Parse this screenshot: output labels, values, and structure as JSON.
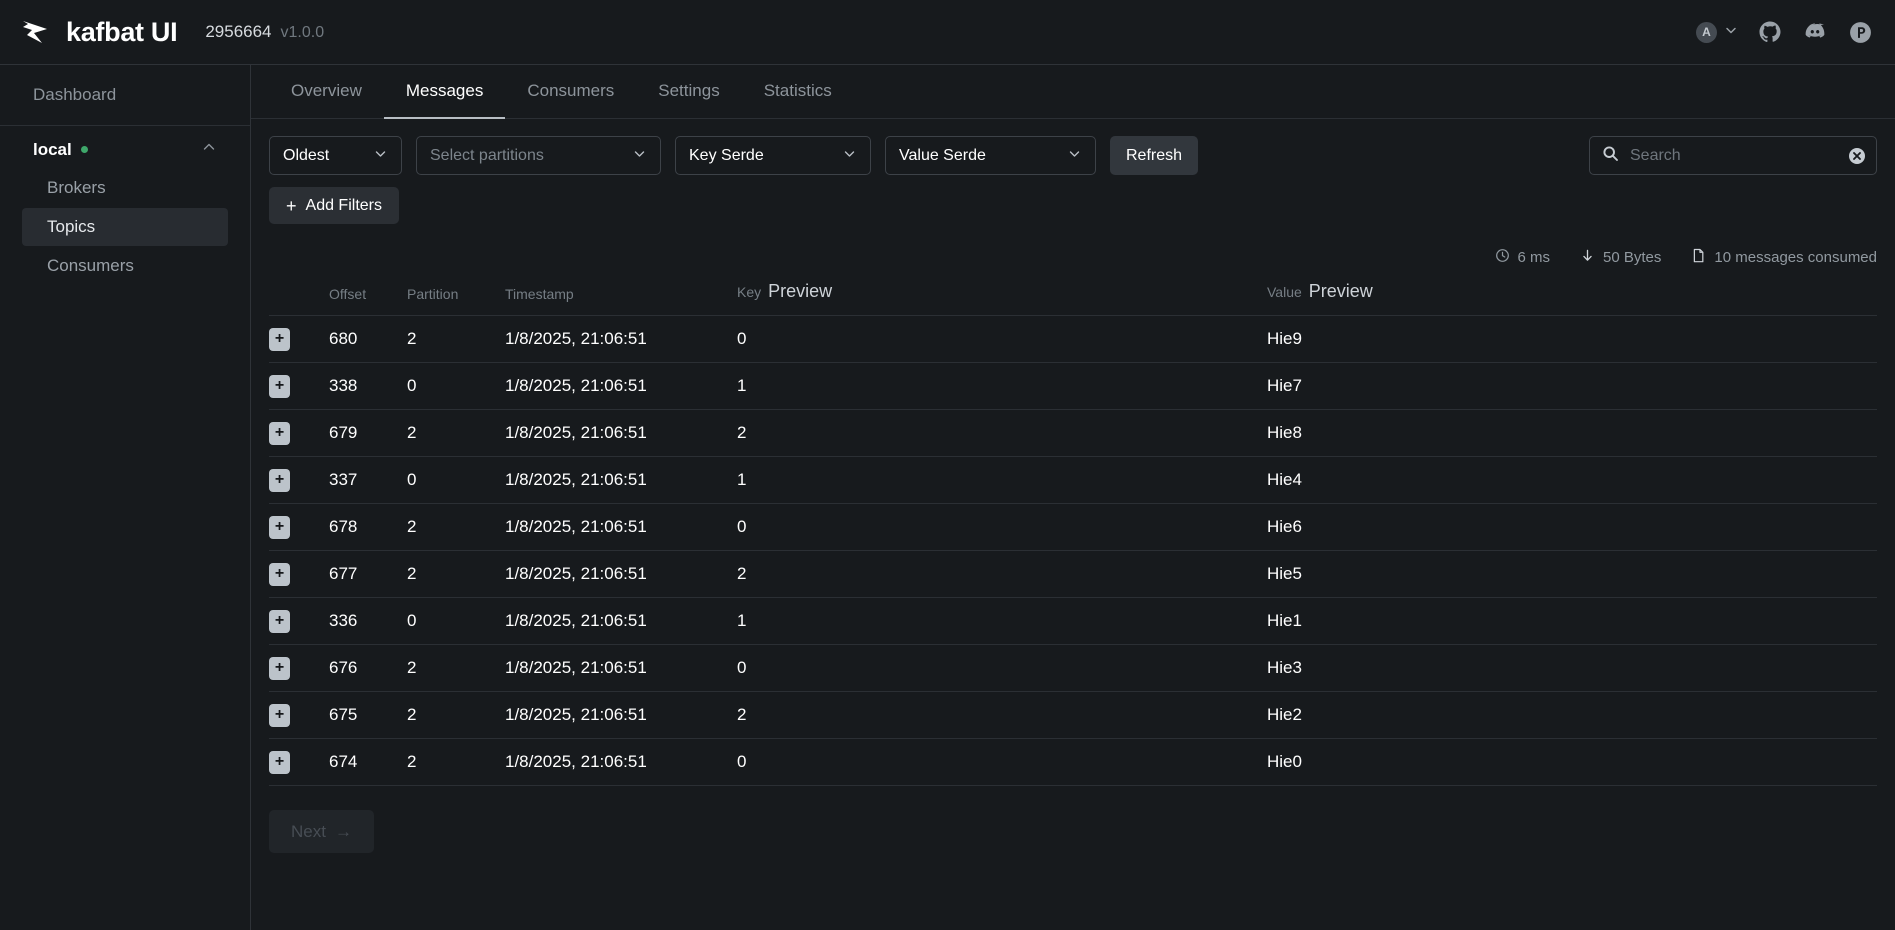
{
  "header": {
    "logo_icon": "kafbat-bird-logo",
    "brand": "kafbat UI",
    "build": "2956664",
    "version": "v1.0.0",
    "user_initial": "A",
    "user_chevron_icon": "chevron-down-icon",
    "github_icon": "github-icon",
    "discord_icon": "discord-icon",
    "product_icon": "circled-p-icon"
  },
  "sidebar": {
    "dashboard_label": "Dashboard",
    "cluster": {
      "name": "local",
      "status_color": "#3ea76a",
      "collapse_icon": "chevron-up-icon"
    },
    "items": [
      {
        "label": "Brokers",
        "active": false
      },
      {
        "label": "Topics",
        "active": true
      },
      {
        "label": "Consumers",
        "active": false
      }
    ]
  },
  "tabs": [
    {
      "label": "Overview",
      "active": false
    },
    {
      "label": "Messages",
      "active": true
    },
    {
      "label": "Consumers",
      "active": false
    },
    {
      "label": "Settings",
      "active": false
    },
    {
      "label": "Statistics",
      "active": false
    }
  ],
  "filters": {
    "seek_type": "Oldest",
    "partitions_placeholder": "Select partitions",
    "key_serde": "Key Serde",
    "value_serde": "Value Serde",
    "refresh_label": "Refresh",
    "add_filters_label": "Add Filters",
    "add_filters_plus": "+",
    "dropdown_icon": "chevron-down-icon"
  },
  "search": {
    "placeholder": "Search",
    "value": "",
    "search_icon": "search-icon",
    "clear_icon": "clear-circle-icon"
  },
  "stats": {
    "elapsed": "6 ms",
    "elapsed_icon": "clock-icon",
    "bytes": "50 Bytes",
    "bytes_icon": "arrow-down-icon",
    "messages": "10 messages consumed",
    "messages_icon": "file-icon"
  },
  "table": {
    "headers": {
      "offset": "Offset",
      "partition": "Partition",
      "timestamp": "Timestamp",
      "key_small": "Key",
      "key_big": "Preview",
      "value_small": "Value",
      "value_big": "Preview"
    },
    "expand_glyph": "+",
    "rows": [
      {
        "offset": "680",
        "partition": "2",
        "timestamp": "1/8/2025, 21:06:51",
        "key": "0",
        "value": "Hie9"
      },
      {
        "offset": "338",
        "partition": "0",
        "timestamp": "1/8/2025, 21:06:51",
        "key": "1",
        "value": "Hie7"
      },
      {
        "offset": "679",
        "partition": "2",
        "timestamp": "1/8/2025, 21:06:51",
        "key": "2",
        "value": "Hie8"
      },
      {
        "offset": "337",
        "partition": "0",
        "timestamp": "1/8/2025, 21:06:51",
        "key": "1",
        "value": "Hie4"
      },
      {
        "offset": "678",
        "partition": "2",
        "timestamp": "1/8/2025, 21:06:51",
        "key": "0",
        "value": "Hie6"
      },
      {
        "offset": "677",
        "partition": "2",
        "timestamp": "1/8/2025, 21:06:51",
        "key": "2",
        "value": "Hie5"
      },
      {
        "offset": "336",
        "partition": "0",
        "timestamp": "1/8/2025, 21:06:51",
        "key": "1",
        "value": "Hie1"
      },
      {
        "offset": "676",
        "partition": "2",
        "timestamp": "1/8/2025, 21:06:51",
        "key": "0",
        "value": "Hie3"
      },
      {
        "offset": "675",
        "partition": "2",
        "timestamp": "1/8/2025, 21:06:51",
        "key": "2",
        "value": "Hie2"
      },
      {
        "offset": "674",
        "partition": "2",
        "timestamp": "1/8/2025, 21:06:51",
        "key": "0",
        "value": "Hie0"
      }
    ]
  },
  "pagination": {
    "next_label": "Next",
    "next_arrow": "→",
    "next_disabled": true
  }
}
